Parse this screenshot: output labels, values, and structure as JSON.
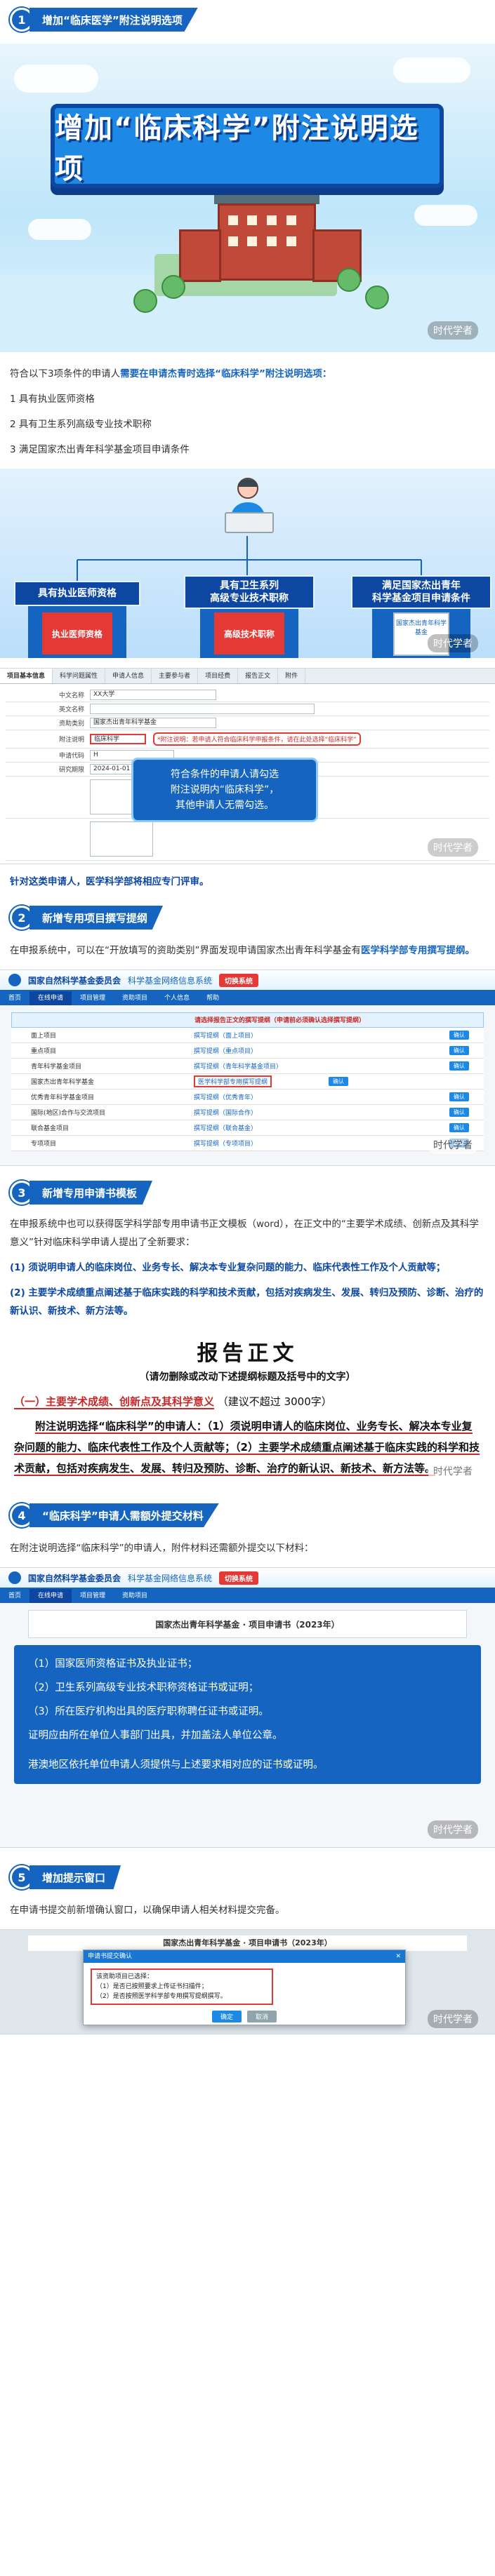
{
  "sections": [
    {
      "number": "1",
      "title": "增加“临床医学”附注说明选项"
    },
    {
      "number": "2",
      "title": "新增专用项目撰写提纲"
    },
    {
      "number": "3",
      "title": "新增专用申请书模板"
    },
    {
      "number": "4",
      "title": "“临床科学”申请人需额外提交材料"
    },
    {
      "number": "5",
      "title": "增加提示窗口"
    }
  ],
  "hero": {
    "banner_text": "增加“临床科学”附注说明选项",
    "watermark": "时代学者"
  },
  "s1": {
    "intro_plain": "符合以下3项条件的申请人",
    "intro_em": "需要在申请杰青时选择“临床科学”附注说明选项：",
    "conditions": [
      "1 具有执业医师资格",
      "2 具有卫生系列高级专业技术职称",
      "3 满足国家杰出青年科学基金项目申请条件"
    ],
    "cards": [
      {
        "label": "具有执业医师资格",
        "box": "执业医师资格"
      },
      {
        "label": "具有卫生系列\n高级专业技术职称",
        "box": "高级技术职称"
      },
      {
        "label": "满足国家杰出青年\n科学基金项目申请条件",
        "box": "国家杰出青年科学基金"
      }
    ],
    "form_tabs": [
      "项目基本信息",
      "科学问题属性",
      "申请人信息",
      "主要参与者",
      "项目经费",
      "报告正文",
      "附件"
    ],
    "form_rows": [
      {
        "label": "中文名称",
        "value": "XX大学"
      },
      {
        "label": "英文名称",
        "value": ""
      },
      {
        "label": "资助类别",
        "value": "国家杰出青年科学基金"
      },
      {
        "label": "附注说明",
        "value": "临床科学"
      },
      {
        "label": "申请代码",
        "value": "H"
      },
      {
        "label": "研究期限",
        "value": "2024-01-01 至 2028-12-31"
      }
    ],
    "form_note": "*附注说明：若申请人符合临床科学申报条件，请在此处选择“临床科学”",
    "popup_text": "符合条件的申请人请勾选\n附注说明内“临床科学”，\n其他申请人无需勾选。",
    "closing": "针对这类申请人，医学科学部将相应专门评审。"
  },
  "s2": {
    "text_plain": "在申报系统中，可以在“开放填写的资助类别”界面发现申请国家杰出青年科学基金有",
    "text_em": "医学科学部专用撰写提纲。",
    "system_name": "国家自然科学基金委员会",
    "system_sub": "科学基金网络信息系统",
    "pill": "切换系统",
    "menu": [
      "首页",
      "在线申请",
      "项目管理",
      "资助项目",
      "个人信息",
      "帮助"
    ],
    "list_header": "请选择报告正文的撰写提纲（申请前必须确认选择撰写提纲）",
    "rows": [
      {
        "name": "面上项目",
        "outline": "撰写提纲（面上项目）",
        "btn": "确认"
      },
      {
        "name": "重点项目",
        "outline": "撰写提纲（重点项目）",
        "btn": "确认"
      },
      {
        "name": "青年科学基金项目",
        "outline": "撰写提纲（青年科学基金项目）",
        "btn": "确认"
      },
      {
        "name": "国家杰出青年科学基金",
        "outline": "医学科学部专用撰写提纲",
        "btn": "确认"
      },
      {
        "name": "优秀青年科学基金项目",
        "outline": "撰写提纲（优秀青年）",
        "btn": "确认"
      },
      {
        "name": "国际(地区)合作与交流项目",
        "outline": "撰写提纲（国际合作）",
        "btn": "确认"
      },
      {
        "name": "联合基金项目",
        "outline": "撰写提纲（联合基金）",
        "btn": "确认"
      },
      {
        "name": "专项项目",
        "outline": "撰写提纲（专项项目）",
        "btn": "确认"
      }
    ]
  },
  "s3": {
    "text_plain": "在申报系统中也可以获得医学科学部专用申请书正文模板（word），在正文中的“主要学术成绩、创新点及其科学意义”针对临床科学申请人提出了全新要求：",
    "req1": "(1) 须说明申请人的临床岗位、业务专长、解决本专业复杂问题的能力、临床代表性工作及个人贡献等；",
    "req2": "(2) 主要学术成绩重点阐述基于临床实践的科学和技术贡献，包括对疾病发生、发展、转归及预防、诊断、治疗的新认识、新技术、新方法等。",
    "doc_title": "报告正文",
    "doc_sub": "（请勿删除或改动下述提纲标题及括号中的文字）",
    "item_em": "（一）主要学术成绩、创新点及其科学意义",
    "item_note": "（建议不超过 3000字）",
    "body_p1": "附注说明选择“临床科学”的申请人：（1）须说明申请人的临床岗位、业务专长、解决本专业复杂问题的能力、临床代表性工作及个人贡献等；（2）主要学术成绩重点阐述基于临床实践的科学和技术贡献，包括对疾病发生、发展、转归及预防、诊断、治疗的新认识、新技术、新方法等。"
  },
  "s4": {
    "text": "在附注说明选择“临床科学”的申请人，附件材料还需额外提交以下材料：",
    "doc_header": "国家杰出青年科学基金 · 项目申请书（2023年）",
    "items": [
      "（1）国家医师资格证书及执业证书；",
      "（2）卫生系列高级专业技术职称资格证书或证明；",
      "（3）所在医疗机构出具的医疗职称聘任证书或证明。",
      "证明应由所在单位人事部门出具，并加盖法人单位公章。",
      "港澳地区依托单位申请人须提供与上述要求相对应的证书或证明。"
    ]
  },
  "s5": {
    "text": "在申请书提交前新增确认窗口，以确保申请人相关材料提交完备。",
    "doc_header": "国家杰出青年科学基金 · 项目申请书（2023年）",
    "dialog_title": "申请书提交确认",
    "dialog_lines": [
      "该资助项目已选择：",
      "（1）是否已按照要求上传证书扫描件；",
      "（2）是否按照医学科学部专用撰写提纲撰写。"
    ],
    "btn_ok": "确定",
    "btn_cancel": "取消"
  },
  "colors": {
    "primary": "#1565c0",
    "dark": "#0d47a1",
    "accent_red": "#e53935"
  }
}
